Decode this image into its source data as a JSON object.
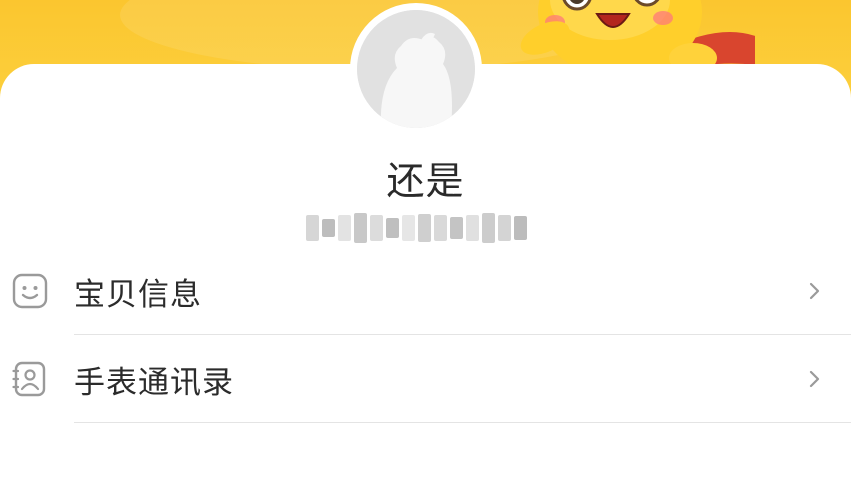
{
  "profile": {
    "name": "还是",
    "masked_id_note": ""
  },
  "menu": {
    "items": [
      {
        "label": "宝贝信息",
        "icon": "smiley-face-icon"
      },
      {
        "label": "手表通讯录",
        "icon": "contact-book-icon"
      }
    ]
  },
  "colors": {
    "header": "#fbc62f",
    "text": "#2b2b2b",
    "divider": "#e4e4e4",
    "chevron": "#9a9a9a"
  }
}
